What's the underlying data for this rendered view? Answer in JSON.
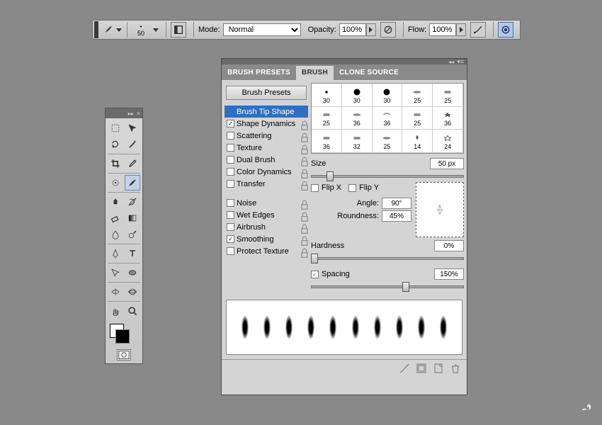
{
  "options_bar": {
    "brush_preset_size": "50",
    "mode_label": "Mode:",
    "mode_value": "Normal",
    "opacity_label": "Opacity:",
    "opacity_value": "100%",
    "flow_label": "Flow:",
    "flow_value": "100%"
  },
  "toolbox": {
    "tools": [
      "marquee",
      "move",
      "lasso",
      "magic-wand",
      "crop",
      "eyedropper",
      "spot-heal",
      "brush",
      "clone-stamp",
      "history-brush",
      "eraser",
      "gradient",
      "blur",
      "dodge",
      "pen",
      "type",
      "path-select",
      "shape",
      "3d-rotate",
      "3d-orbit",
      "hand",
      "zoom"
    ],
    "selected_tool": "brush"
  },
  "panel": {
    "tabs": [
      "BRUSH PRESETS",
      "BRUSH",
      "CLONE SOURCE"
    ],
    "active_tab": "BRUSH",
    "presets_button": "Brush Presets",
    "options": [
      {
        "label": "Brush Tip Shape",
        "checkbox": false,
        "checked": false,
        "selected": true
      },
      {
        "label": "Shape Dynamics",
        "checkbox": true,
        "checked": true
      },
      {
        "label": "Scattering",
        "checkbox": true,
        "checked": false
      },
      {
        "label": "Texture",
        "checkbox": true,
        "checked": false
      },
      {
        "label": "Dual Brush",
        "checkbox": true,
        "checked": false
      },
      {
        "label": "Color Dynamics",
        "checkbox": true,
        "checked": false
      },
      {
        "label": "Transfer",
        "checkbox": true,
        "checked": false
      }
    ],
    "options2": [
      {
        "label": "Noise",
        "checkbox": true,
        "checked": false
      },
      {
        "label": "Wet Edges",
        "checkbox": true,
        "checked": false
      },
      {
        "label": "Airbrush",
        "checkbox": true,
        "checked": false
      },
      {
        "label": "Smoothing",
        "checkbox": true,
        "checked": true
      },
      {
        "label": "Protect Texture",
        "checkbox": true,
        "checked": false
      }
    ],
    "swatches": [
      30,
      30,
      30,
      25,
      25,
      25,
      36,
      36,
      25,
      36,
      36,
      32,
      25,
      14,
      24
    ],
    "size_label": "Size",
    "size_value": "50 px",
    "flipx_label": "Flip X",
    "flipy_label": "Flip Y",
    "angle_label": "Angle:",
    "angle_value": "90°",
    "roundness_label": "Roundness:",
    "roundness_value": "45%",
    "hardness_label": "Hardness",
    "hardness_value": "0%",
    "spacing_label": "Spacing",
    "spacing_checked": true,
    "spacing_value": "150%"
  }
}
